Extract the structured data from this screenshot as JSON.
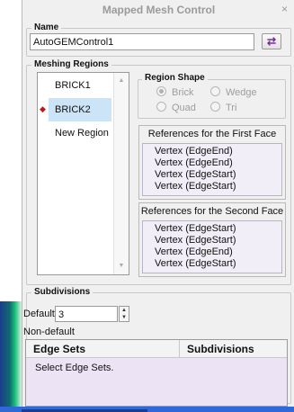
{
  "dialog": {
    "title": "Mapped Mesh Control",
    "close_glyph": "×"
  },
  "name_section": {
    "legend": "Name",
    "value": "AutoGEMControl1",
    "select_button_icon": "selection-arrows-icon"
  },
  "meshing_regions": {
    "legend": "Meshing Regions",
    "items": [
      {
        "label": "BRICK1",
        "selected": false,
        "marker": ""
      },
      {
        "label": "BRICK2",
        "selected": true,
        "marker": "◆"
      },
      {
        "label": "New Region",
        "selected": false,
        "marker": ""
      }
    ]
  },
  "region_shape": {
    "legend": "Region Shape",
    "options": [
      {
        "label": "Brick",
        "checked": true
      },
      {
        "label": "Wedge",
        "checked": false
      },
      {
        "label": "Quad",
        "checked": false
      },
      {
        "label": "Tri",
        "checked": false
      }
    ]
  },
  "first_face": {
    "heading": "References for the First Face",
    "refs": [
      "Vertex (EdgeEnd)",
      "Vertex (EdgeEnd)",
      "Vertex (EdgeStart)",
      "Vertex (EdgeStart)"
    ]
  },
  "second_face": {
    "heading": "References for the Second Face",
    "refs": [
      "Vertex (EdgeStart)",
      "Vertex (EdgeStart)",
      "Vertex (EdgeEnd)",
      "Vertex (EdgeStart)"
    ]
  },
  "subdivisions": {
    "legend": "Subdivisions",
    "default_label": "Default",
    "default_value": "3",
    "non_default_label": "Non-default",
    "table": {
      "columns": [
        "Edge Sets",
        "Subdivisions"
      ],
      "placeholder": "Select Edge Sets."
    }
  },
  "colors": {
    "selected_row": "#cce4f7",
    "marker": "#cc1010",
    "ref_list_bg": "#f1eef7",
    "table_body_bg": "#ece4f4"
  }
}
